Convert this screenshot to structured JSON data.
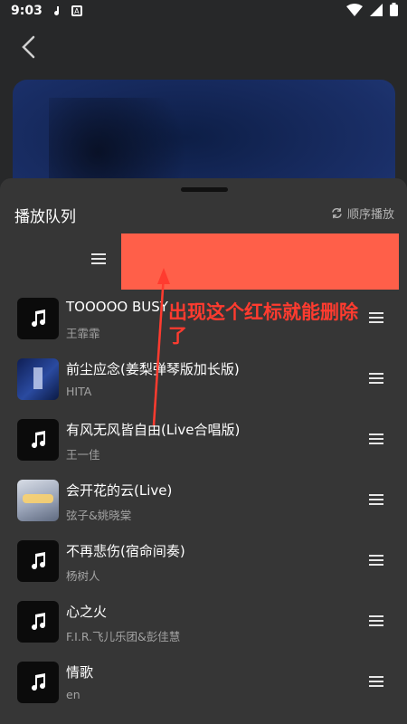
{
  "status_bar": {
    "time": "9:03"
  },
  "sheet": {
    "title": "播放队列",
    "order_label": "顺序播放"
  },
  "annotation": {
    "text": "出现这个红标就能删除了"
  },
  "songs": [
    {
      "title": "TOOOOO BUSY",
      "artist": "王霏霏"
    },
    {
      "title": "前尘应念(姜梨弹琴版加长版)",
      "artist": "HITA"
    },
    {
      "title": "有风无风皆自由(Live合唱版)",
      "artist": "王一佳"
    },
    {
      "title": "会开花的云(Live)",
      "artist": "弦子&姚晓棠"
    },
    {
      "title": "不再悲伤(宿命间奏)",
      "artist": "杨树人"
    },
    {
      "title": "心之火",
      "artist": "F.I.R.飞儿乐团&彭佳慧"
    },
    {
      "title": "情歌",
      "artist": "en"
    }
  ],
  "colors": {
    "sheet_bg": "#363636",
    "delete_marker": "#ff5f49",
    "annotation": "#ff3b2f"
  },
  "icons": [
    "back-icon",
    "repeat-order-icon",
    "drag-handle-icon",
    "music-note-icon",
    "wifi-icon",
    "battery-icon"
  ]
}
